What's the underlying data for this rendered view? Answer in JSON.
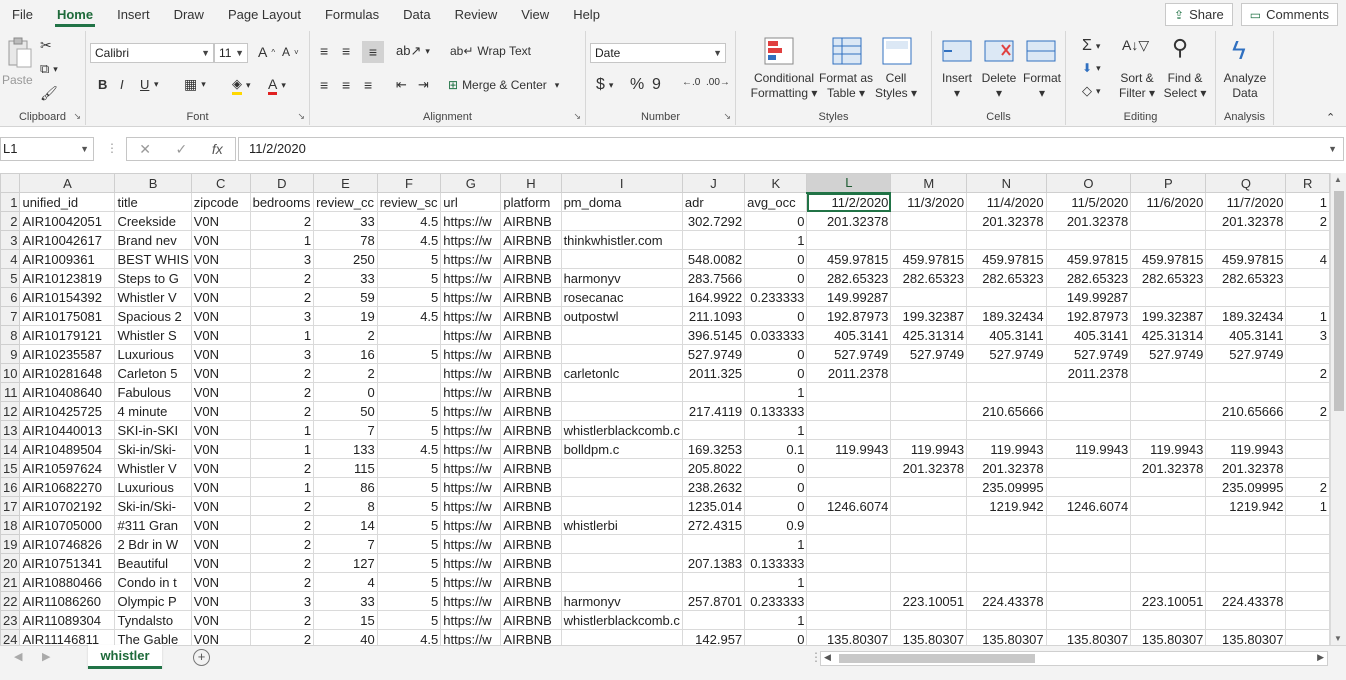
{
  "menu": {
    "items": [
      "File",
      "Home",
      "Insert",
      "Draw",
      "Page Layout",
      "Formulas",
      "Data",
      "Review",
      "View",
      "Help"
    ],
    "share": "Share",
    "comments": "Comments"
  },
  "ribbon": {
    "clipboard": {
      "label": "Clipboard",
      "paste": "Paste"
    },
    "font": {
      "label": "Font",
      "name": "Calibri",
      "size": "11",
      "bold": "B",
      "italic": "I",
      "underline": "U",
      "grow": "A",
      "shrink": "A"
    },
    "alignment": {
      "label": "Alignment",
      "wrap": "Wrap Text",
      "merge": "Merge & Center"
    },
    "number": {
      "label": "Number",
      "format": "Date",
      "currency": "$",
      "percent": "%",
      "comma": "9"
    },
    "styles": {
      "label": "Styles",
      "conditional": [
        "Conditional",
        "Formatting"
      ],
      "format_table": [
        "Format as",
        "Table"
      ],
      "cell_styles": [
        "Cell",
        "Styles"
      ]
    },
    "cells": {
      "label": "Cells",
      "insert": "Insert",
      "delete": "Delete",
      "format": "Format"
    },
    "editing": {
      "label": "Editing",
      "sort": [
        "Sort &",
        "Filter"
      ],
      "find": [
        "Find &",
        "Select"
      ]
    },
    "analysis": {
      "label": "Analysis",
      "analyze": [
        "Analyze",
        "Data"
      ]
    }
  },
  "formula_bar": {
    "name_box": "L1",
    "fx": "fx",
    "value": "11/2/2020"
  },
  "columns": [
    "A",
    "B",
    "C",
    "D",
    "E",
    "F",
    "G",
    "H",
    "I",
    "J",
    "K",
    "L",
    "M",
    "N",
    "O",
    "P",
    "Q",
    "R"
  ],
  "rows": [
    [
      "unified_id",
      "title",
      "zipcode",
      "bedrooms",
      "review_cc",
      "review_sc",
      "url",
      "platform",
      "pm_doma",
      "adr",
      "avg_occ",
      "11/2/2020",
      "11/3/2020",
      "11/4/2020",
      "11/5/2020",
      "11/6/2020",
      "11/7/2020",
      "1"
    ],
    [
      "AIR10042051",
      "Creekside",
      "V0N",
      "2",
      "33",
      "4.5",
      "https://w",
      "AIRBNB",
      "",
      "302.7292",
      "0",
      "201.32378",
      "",
      "201.32378",
      "201.32378",
      "",
      "201.32378",
      "2"
    ],
    [
      "AIR10042617",
      "Brand nev",
      "V0N",
      "1",
      "78",
      "4.5",
      "https://w",
      "AIRBNB",
      "thinkwhistler.com",
      "",
      "1",
      "",
      "",
      "",
      "",
      "",
      "",
      ""
    ],
    [
      "AIR1009361",
      "BEST WHIS",
      "V0N",
      "3",
      "250",
      "5",
      "https://w",
      "AIRBNB",
      "",
      "548.0082",
      "0",
      "459.97815",
      "459.97815",
      "459.97815",
      "459.97815",
      "459.97815",
      "459.97815",
      "4"
    ],
    [
      "AIR10123819",
      "Steps to G",
      "V0N",
      "2",
      "33",
      "5",
      "https://w",
      "AIRBNB",
      "harmonyv",
      "283.7566",
      "0",
      "282.65323",
      "282.65323",
      "282.65323",
      "282.65323",
      "282.65323",
      "282.65323",
      ""
    ],
    [
      "AIR10154392",
      "Whistler V",
      "V0N",
      "2",
      "59",
      "5",
      "https://w",
      "AIRBNB",
      "rosecanac",
      "164.9922",
      "0.233333",
      "149.99287",
      "",
      "",
      "149.99287",
      "",
      "",
      ""
    ],
    [
      "AIR10175081",
      "Spacious 2",
      "V0N",
      "3",
      "19",
      "4.5",
      "https://w",
      "AIRBNB",
      "outpostwl",
      "211.1093",
      "0",
      "192.87973",
      "199.32387",
      "189.32434",
      "192.87973",
      "199.32387",
      "189.32434",
      "1"
    ],
    [
      "AIR10179121",
      "Whistler S",
      "V0N",
      "1",
      "2",
      "",
      "https://w",
      "AIRBNB",
      "",
      "396.5145",
      "0.033333",
      "405.3141",
      "425.31314",
      "405.3141",
      "405.3141",
      "425.31314",
      "405.3141",
      "3"
    ],
    [
      "AIR10235587",
      "Luxurious",
      "V0N",
      "3",
      "16",
      "5",
      "https://w",
      "AIRBNB",
      "",
      "527.9749",
      "0",
      "527.9749",
      "527.9749",
      "527.9749",
      "527.9749",
      "527.9749",
      "527.9749",
      ""
    ],
    [
      "AIR10281648",
      "Carleton 5",
      "V0N",
      "2",
      "2",
      "",
      "https://w",
      "AIRBNB",
      "carletonlc",
      "2011.325",
      "0",
      "2011.2378",
      "",
      "",
      "2011.2378",
      "",
      "",
      "2"
    ],
    [
      "AIR10408640",
      "Fabulous",
      "V0N",
      "2",
      "0",
      "",
      "https://w",
      "AIRBNB",
      "",
      "",
      "1",
      "",
      "",
      "",
      "",
      "",
      "",
      ""
    ],
    [
      "AIR10425725",
      "4 minute",
      "V0N",
      "2",
      "50",
      "5",
      "https://w",
      "AIRBNB",
      "",
      "217.4119",
      "0.133333",
      "",
      "",
      "210.65666",
      "",
      "",
      "210.65666",
      "2"
    ],
    [
      "AIR10440013",
      "SKI-in-SKI",
      "V0N",
      "1",
      "7",
      "5",
      "https://w",
      "AIRBNB",
      "whistlerblackcomb.c",
      "",
      "1",
      "",
      "",
      "",
      "",
      "",
      "",
      ""
    ],
    [
      "AIR10489504",
      "Ski-in/Ski-",
      "V0N",
      "1",
      "133",
      "4.5",
      "https://w",
      "AIRBNB",
      "bolldpm.c",
      "169.3253",
      "0.1",
      "119.9943",
      "119.9943",
      "119.9943",
      "119.9943",
      "119.9943",
      "119.9943",
      ""
    ],
    [
      "AIR10597624",
      "Whistler V",
      "V0N",
      "2",
      "115",
      "5",
      "https://w",
      "AIRBNB",
      "",
      "205.8022",
      "0",
      "",
      "201.32378",
      "201.32378",
      "",
      "201.32378",
      "201.32378",
      ""
    ],
    [
      "AIR10682270",
      "Luxurious",
      "V0N",
      "1",
      "86",
      "5",
      "https://w",
      "AIRBNB",
      "",
      "238.2632",
      "0",
      "",
      "",
      "235.09995",
      "",
      "",
      "235.09995",
      "2"
    ],
    [
      "AIR10702192",
      "Ski-in/Ski-",
      "V0N",
      "2",
      "8",
      "5",
      "https://w",
      "AIRBNB",
      "",
      "1235.014",
      "0",
      "1246.6074",
      "",
      "1219.942",
      "1246.6074",
      "",
      "1219.942",
      "1"
    ],
    [
      "AIR10705000",
      "#311 Gran",
      "V0N",
      "2",
      "14",
      "5",
      "https://w",
      "AIRBNB",
      "whistlerbi",
      "272.4315",
      "0.9",
      "",
      "",
      "",
      "",
      "",
      "",
      ""
    ],
    [
      "AIR10746826",
      "2 Bdr in W",
      "V0N",
      "2",
      "7",
      "5",
      "https://w",
      "AIRBNB",
      "",
      "",
      "1",
      "",
      "",
      "",
      "",
      "",
      "",
      ""
    ],
    [
      "AIR10751341",
      "Beautiful",
      "V0N",
      "2",
      "127",
      "5",
      "https://w",
      "AIRBNB",
      "",
      "207.1383",
      "0.133333",
      "",
      "",
      "",
      "",
      "",
      "",
      ""
    ],
    [
      "AIR10880466",
      "Condo in t",
      "V0N",
      "2",
      "4",
      "5",
      "https://w",
      "AIRBNB",
      "",
      "",
      "1",
      "",
      "",
      "",
      "",
      "",
      "",
      ""
    ],
    [
      "AIR11086260",
      "Olympic P",
      "V0N",
      "3",
      "33",
      "5",
      "https://w",
      "AIRBNB",
      "harmonyv",
      "257.8701",
      "0.233333",
      "",
      "223.10051",
      "224.43378",
      "",
      "223.10051",
      "224.43378",
      ""
    ],
    [
      "AIR11089304",
      "Tyndalsto",
      "V0N",
      "2",
      "15",
      "5",
      "https://w",
      "AIRBNB",
      "whistlerblackcomb.c",
      "",
      "1",
      "",
      "",
      "",
      "",
      "",
      "",
      ""
    ],
    [
      "AIR11146811",
      "The Gable",
      "V0N",
      "2",
      "40",
      "4.5",
      "https://w",
      "AIRBNB",
      "",
      "142.957",
      "0",
      "135.80307",
      "135.80307",
      "135.80307",
      "135.80307",
      "135.80307",
      "135.80307",
      ""
    ]
  ],
  "sheet_tab": "whistler",
  "add_sheet": "+",
  "colors": {
    "accent": "#217346"
  }
}
